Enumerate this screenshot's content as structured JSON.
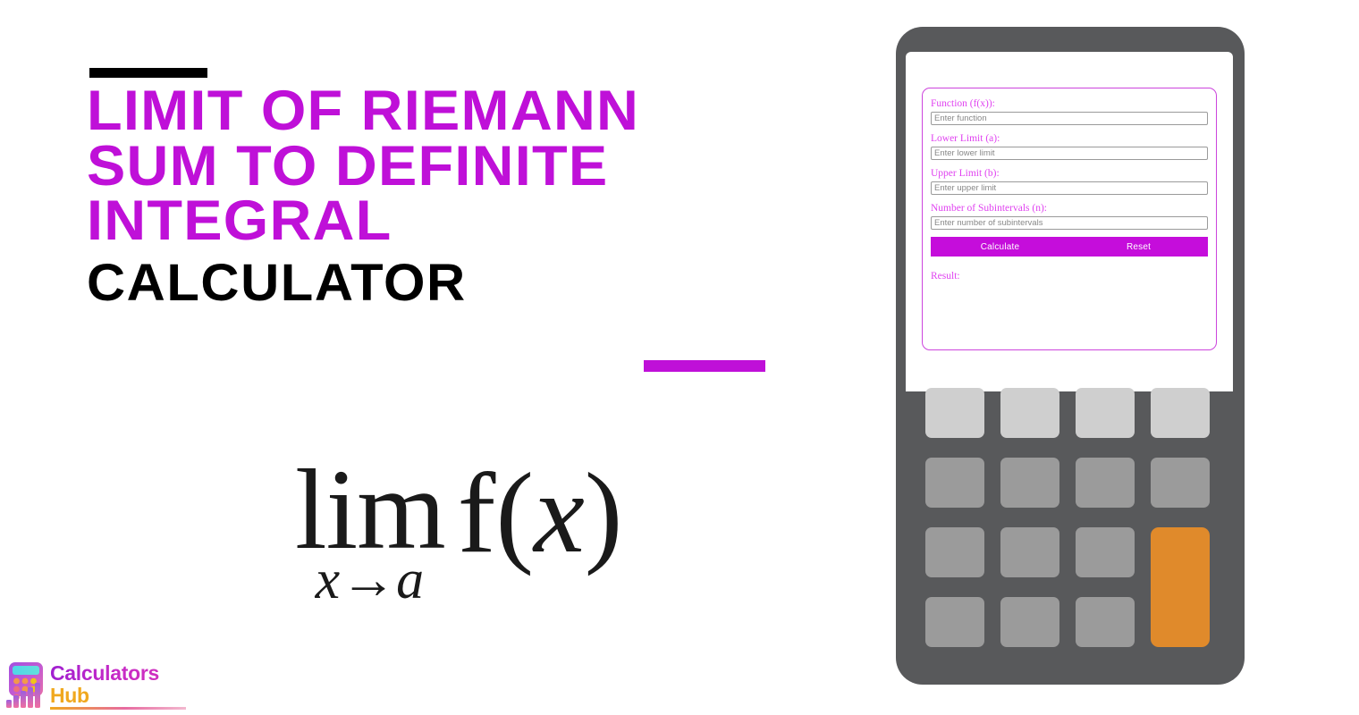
{
  "page": {
    "background_color": "#ffffff",
    "accent_purple": "#bf10d8",
    "accent_black": "#000000"
  },
  "title": {
    "line1": "Limit of Riemann",
    "line2": "Sum to Definite",
    "line3": "Integral",
    "subtitle": "Calculator",
    "color": "#bf10d8",
    "subtitle_color": "#000000"
  },
  "formula": {
    "operator": "lim",
    "subscript_variable": "x",
    "subscript_arrow": "→",
    "subscript_target": "a",
    "expression_prefix": "f(",
    "expression_variable": "x",
    "expression_suffix": ")",
    "plain": "lim x→a f(x)"
  },
  "logo": {
    "word1": "Calculators",
    "word2": "Hub",
    "word1_color": "#b723c8",
    "word2_color": "#f0a81e"
  },
  "calculator": {
    "body_color": "#58595b",
    "screen_color": "#ffffff",
    "form_border_color": "#cc44dd",
    "fields": [
      {
        "label": "Function (f(x)):",
        "placeholder": "Enter function",
        "value": ""
      },
      {
        "label": "Lower Limit (a):",
        "placeholder": "Enter lower limit",
        "value": ""
      },
      {
        "label": "Upper Limit (b):",
        "placeholder": "Enter upper limit",
        "value": ""
      },
      {
        "label": "Number of Subintervals (n):",
        "placeholder": "Enter number of subintervals",
        "value": ""
      }
    ],
    "actions": {
      "calculate_label": "Calculate",
      "reset_label": "Reset",
      "button_color": "#c50ddb"
    },
    "result": {
      "label": "Result:",
      "value": ""
    },
    "keypad": {
      "rows": 4,
      "columns": 4,
      "light_key_color": "#cfcfcf",
      "mid_key_color": "#9b9b9b",
      "accent_key_color": "#e08a2b"
    }
  }
}
